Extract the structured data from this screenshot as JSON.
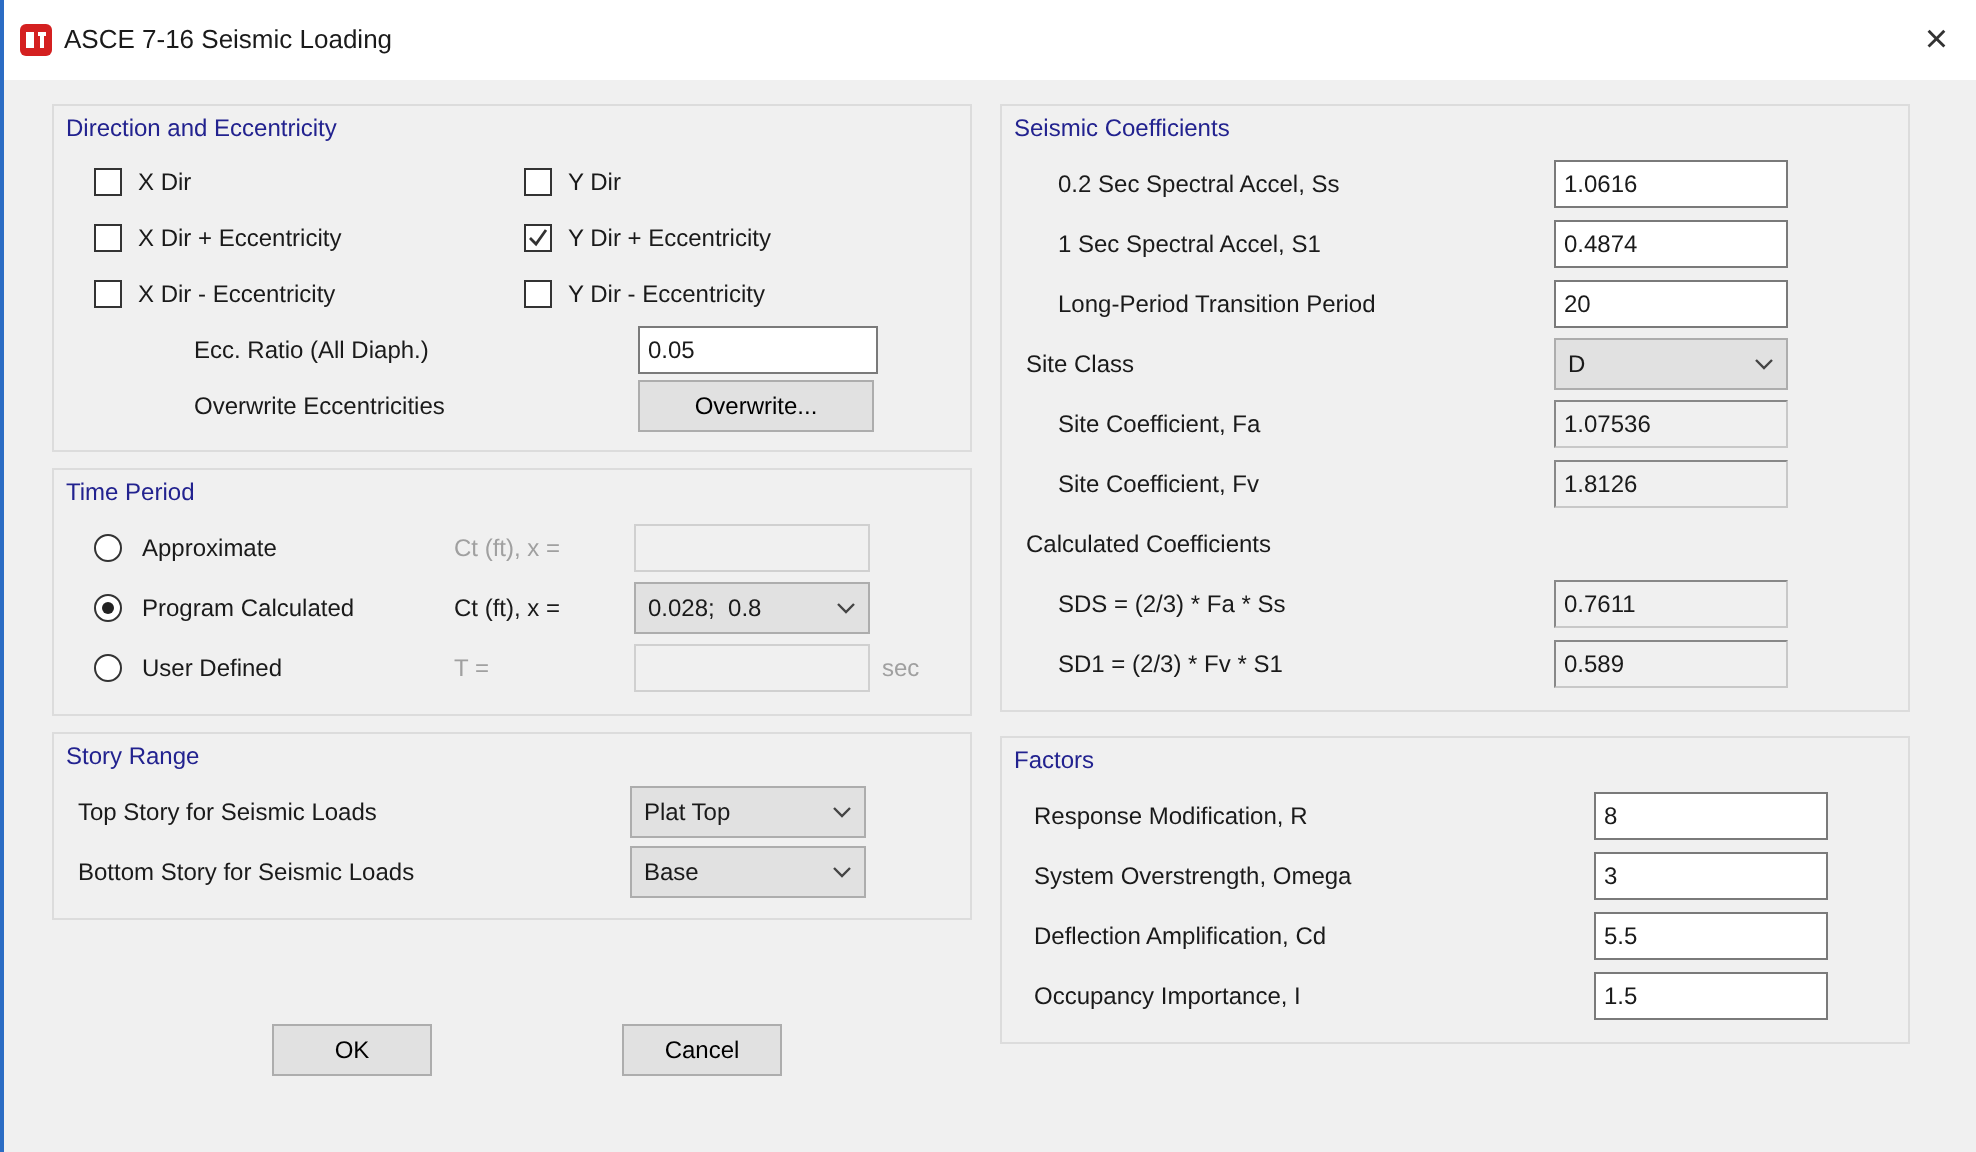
{
  "window": {
    "title": "ASCE 7-16 Seismic Loading",
    "close": "×"
  },
  "direction": {
    "title": "Direction and Eccentricity",
    "checkboxes": [
      {
        "label": "X Dir",
        "checked": false
      },
      {
        "label": "Y Dir",
        "checked": false
      },
      {
        "label": "X Dir + Eccentricity",
        "checked": false
      },
      {
        "label": "Y Dir + Eccentricity",
        "checked": true
      },
      {
        "label": "X Dir - Eccentricity",
        "checked": false
      },
      {
        "label": "Y Dir - Eccentricity",
        "checked": false
      }
    ],
    "ecc_ratio": {
      "label": "Ecc. Ratio (All Diaph.)",
      "value": "0.05"
    },
    "overwrite": {
      "label": "Overwrite Eccentricities",
      "button": "Overwrite..."
    }
  },
  "time_period": {
    "title": "Time Period",
    "options": [
      {
        "label": "Approximate",
        "selected": false,
        "field_label": "Ct (ft), x =",
        "kind": "input",
        "disabled": true
      },
      {
        "label": "Program Calculated",
        "selected": true,
        "field_label": "Ct (ft), x =",
        "kind": "select",
        "value": "0.028;  0.8",
        "disabled": false
      },
      {
        "label": "User Defined",
        "selected": false,
        "field_label": "T =",
        "kind": "input",
        "disabled": true,
        "unit": "sec"
      }
    ]
  },
  "story_range": {
    "title": "Story Range",
    "rows": [
      {
        "label": "Top Story for Seismic Loads",
        "value": "Plat Top"
      },
      {
        "label": "Bottom Story for Seismic Loads",
        "value": "Base"
      }
    ]
  },
  "buttons": [
    "OK",
    "Cancel"
  ],
  "seismic": {
    "title": "Seismic Coefficients",
    "rows": [
      {
        "kind": "input",
        "label": "0.2 Sec Spectral Accel, Ss",
        "value": "1.0616"
      },
      {
        "kind": "input",
        "label": "1 Sec Spectral Accel, S1",
        "value": "0.4874"
      },
      {
        "kind": "input",
        "label": "Long-Period Transition Period",
        "value": "20"
      },
      {
        "kind": "select",
        "label": "Site Class",
        "value": "D"
      },
      {
        "kind": "readonly",
        "label": "Site Coefficient, Fa",
        "value": "1.07536"
      },
      {
        "kind": "readonly",
        "label": "Site Coefficient, Fv",
        "value": "1.8126"
      },
      {
        "kind": "heading",
        "label": "Calculated Coefficients"
      },
      {
        "kind": "readonly",
        "label": "SDS = (2/3) * Fa * Ss",
        "value": "0.7611"
      },
      {
        "kind": "readonly",
        "label": "SD1 = (2/3) * Fv * S1",
        "value": "0.589"
      }
    ]
  },
  "factors": {
    "title": "Factors",
    "rows": [
      {
        "label": "Response Modification, R",
        "value": "8"
      },
      {
        "label": "System Overstrength, Omega",
        "value": "3"
      },
      {
        "label": "Deflection Amplification, Cd",
        "value": "5.5"
      },
      {
        "label": "Occupancy Importance, I",
        "value": "1.5"
      }
    ]
  }
}
